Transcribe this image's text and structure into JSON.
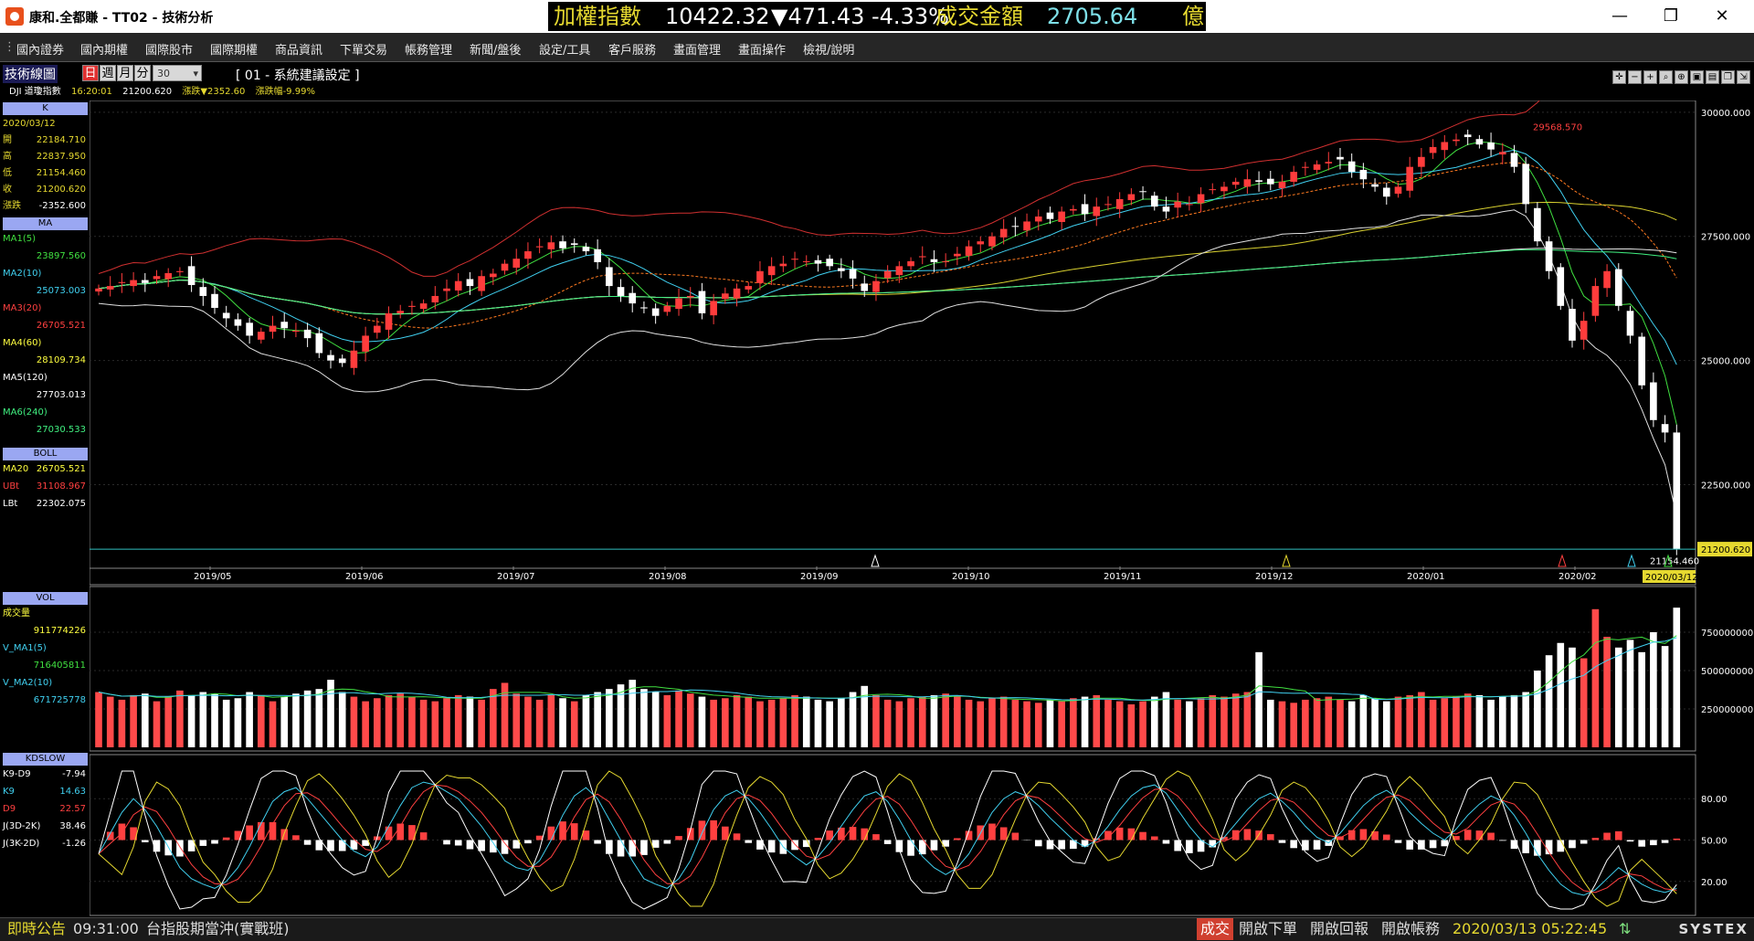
{
  "window": {
    "title": "康和.全都賺 - TT02 - 技術分析",
    "minimize": "—",
    "restore": "❐",
    "close": "✕"
  },
  "ticker": {
    "name": "加權指數",
    "value": "10422.32",
    "change": "▼471.43",
    "pct": "-4.33%",
    "vol_label": "成交金額",
    "vol_value": "2705.64",
    "unit": "億"
  },
  "menu": [
    "國內證券",
    "國內期權",
    "國際股市",
    "國際期權",
    "商品資訊",
    "下單交易",
    "帳務管理",
    "新聞/盤後",
    "設定/工具",
    "客戶服務",
    "畫面管理",
    "畫面操作",
    "檢視/說明"
  ],
  "toolbar": {
    "title": "技術線圖",
    "periods": [
      "日",
      "週",
      "月",
      "分"
    ],
    "period_value": "30",
    "setting": "[ 01 - 系統建議設定 ]",
    "symbol": "DJI 道瓊指數",
    "time": "16:20:01",
    "price": "21200.620",
    "change": "漲跌▼2352.60",
    "pct": "漲跌幅-9.99%"
  },
  "panel_k": {
    "title": "K",
    "date": "2020/03/12",
    "rows": [
      {
        "label": "開",
        "value": "22184.710"
      },
      {
        "label": "高",
        "value": "22837.950"
      },
      {
        "label": "低",
        "value": "21154.460"
      },
      {
        "label": "收",
        "value": "21200.620"
      },
      {
        "label": "漲跌",
        "value": "-2352.600"
      }
    ]
  },
  "panel_ma": {
    "title": "MA",
    "rows": [
      {
        "label": "MA1(5)",
        "value": "23897.560",
        "color": "#40e040"
      },
      {
        "label": "MA2(10)",
        "value": "25073.003",
        "color": "#40d0f0"
      },
      {
        "label": "MA3(20)",
        "value": "26705.521",
        "color": "#ff4040"
      },
      {
        "label": "MA4(60)",
        "value": "28109.734",
        "color": "#ffff40"
      },
      {
        "label": "MA5(120)",
        "value": "27703.013",
        "color": "#ffffff"
      },
      {
        "label": "MA6(240)",
        "value": "27030.533",
        "color": "#40f080"
      }
    ]
  },
  "panel_boll": {
    "title": "BOLL",
    "rows": [
      {
        "label": "MA20",
        "value": "26705.521",
        "color": "#ffff40"
      },
      {
        "label": "UBt",
        "value": "31108.967",
        "color": "#ff4040"
      },
      {
        "label": "LBt",
        "value": "22302.075",
        "color": "#ffffff"
      }
    ]
  },
  "panel_vol": {
    "title": "VOL",
    "rows": [
      {
        "label": "成交量",
        "value": "",
        "color": "#ffff40"
      },
      {
        "label": "",
        "value": "911774226",
        "color": "#ffff40"
      },
      {
        "label": "V_MA1(5)",
        "value": "",
        "color": "#40d0f0"
      },
      {
        "label": "",
        "value": "716405811",
        "color": "#40e040"
      },
      {
        "label": "V_MA2(10)",
        "value": "",
        "color": "#40d0f0"
      },
      {
        "label": "",
        "value": "671725778",
        "color": "#40d0f0"
      }
    ]
  },
  "panel_kd": {
    "title": "KDSLOW",
    "rows": [
      {
        "label": "K9-D9",
        "value": "-7.94",
        "color": "#ffffff"
      },
      {
        "label": "K9",
        "value": "14.63",
        "color": "#40d0f0"
      },
      {
        "label": "D9",
        "value": "22.57",
        "color": "#ff4040"
      },
      {
        "label": "J(3D-2K)",
        "value": "38.46",
        "color": "#ffffff"
      },
      {
        "label": "J(3K-2D)",
        "value": "-1.26",
        "color": "#ffffff"
      }
    ]
  },
  "chart_data": {
    "type": "candlestick",
    "symbol": "DJI 道瓊指數",
    "x_ticks": [
      "2019/05",
      "2019/06",
      "2019/07",
      "2019/08",
      "2019/09",
      "2019/10",
      "2019/11",
      "2019/12",
      "2020/01",
      "2020/02",
      "2020/03"
    ],
    "price_ticks": [
      "30000.000",
      "27500.000",
      "25000.000",
      "22500.000"
    ],
    "vol_ticks": [
      "750000000",
      "500000000",
      "250000000"
    ],
    "kd_ticks": [
      "80.00",
      "50.00",
      "20.00"
    ],
    "price_ylim": [
      21000,
      30200
    ],
    "high_marker": "29568.570",
    "low_marker": "21154.460",
    "last_price": "21200.620",
    "last_date": "2020/03/12",
    "close_series": [
      26450,
      26500,
      26580,
      26620,
      26560,
      26700,
      26760,
      26800,
      26520,
      26300,
      26060,
      25850,
      25700,
      25500,
      25580,
      25700,
      25650,
      25600,
      25450,
      25150,
      25000,
      24950,
      25200,
      25500,
      25700,
      25950,
      26000,
      26100,
      26150,
      26300,
      26450,
      26600,
      26500,
      26700,
      26750,
      26950,
      27050,
      27200,
      27300,
      27380,
      27260,
      27330,
      27200,
      26980,
      26500,
      26300,
      26150,
      26050,
      25900,
      26100,
      26250,
      26300,
      25950,
      26200,
      26350,
      26450,
      26500,
      26800,
      26900,
      26950,
      27050,
      27000,
      26950,
      26900,
      26800,
      26650,
      26400,
      26600,
      26800,
      26900,
      27000,
      27100,
      26980,
      27000,
      27150,
      27300,
      27400,
      27500,
      27650,
      27700,
      27800,
      27900,
      27850,
      28000,
      28050,
      27950,
      28100,
      28150,
      28250,
      28350,
      28400,
      28100,
      28000,
      28200,
      28150,
      28350,
      28450,
      28500,
      28600,
      28650,
      28600,
      28550,
      28600,
      28800,
      28900,
      28950,
      29000,
      29050,
      28800,
      28650,
      28500,
      28300,
      28500,
      28900,
      29100,
      29300,
      29400,
      29450,
      29500,
      29350,
      29250,
      29200,
      28900,
      28150,
      27400,
      26800,
      26100,
      25400,
      25800,
      26500,
      26800,
      26100,
      25500,
      24500,
      23800,
      23550,
      21200
    ],
    "volume_series": [
      0.36,
      0.33,
      0.31,
      0.34,
      0.35,
      0.3,
      0.33,
      0.37,
      0.34,
      0.36,
      0.35,
      0.31,
      0.32,
      0.36,
      0.34,
      0.3,
      0.33,
      0.35,
      0.37,
      0.38,
      0.44,
      0.36,
      0.33,
      0.3,
      0.32,
      0.34,
      0.35,
      0.33,
      0.31,
      0.3,
      0.32,
      0.34,
      0.33,
      0.31,
      0.38,
      0.42,
      0.35,
      0.33,
      0.31,
      0.34,
      0.32,
      0.3,
      0.34,
      0.36,
      0.38,
      0.41,
      0.44,
      0.38,
      0.36,
      0.34,
      0.37,
      0.35,
      0.33,
      0.31,
      0.32,
      0.34,
      0.33,
      0.3,
      0.31,
      0.32,
      0.34,
      0.33,
      0.31,
      0.3,
      0.32,
      0.36,
      0.4,
      0.34,
      0.31,
      0.3,
      0.32,
      0.33,
      0.34,
      0.35,
      0.33,
      0.31,
      0.3,
      0.32,
      0.33,
      0.31,
      0.3,
      0.29,
      0.31,
      0.3,
      0.32,
      0.33,
      0.34,
      0.31,
      0.3,
      0.28,
      0.3,
      0.33,
      0.36,
      0.31,
      0.3,
      0.32,
      0.34,
      0.33,
      0.35,
      0.36,
      0.62,
      0.31,
      0.3,
      0.29,
      0.31,
      0.32,
      0.33,
      0.31,
      0.3,
      0.34,
      0.32,
      0.3,
      0.33,
      0.34,
      0.36,
      0.31,
      0.32,
      0.33,
      0.35,
      0.34,
      0.31,
      0.33,
      0.34,
      0.36,
      0.5,
      0.6,
      0.68,
      0.65,
      0.58,
      0.9,
      0.72,
      0.65,
      0.7,
      0.62,
      0.75,
      0.66,
      0.91
    ],
    "k9": [
      40,
      55,
      70,
      80,
      72,
      60,
      45,
      30,
      22,
      18,
      15,
      20,
      30,
      45,
      62,
      78,
      85,
      88,
      80,
      70,
      60,
      50,
      42,
      38,
      45,
      60,
      75,
      88,
      92,
      90,
      85,
      80,
      70,
      60,
      48,
      35,
      30,
      28,
      35,
      50,
      68,
      82,
      88,
      80,
      65,
      50,
      35,
      22,
      18,
      15,
      22,
      35,
      55,
      72,
      82,
      86,
      80,
      70,
      58,
      45,
      38,
      32,
      38,
      48,
      60,
      72,
      82,
      85,
      78,
      65,
      50,
      38,
      30,
      25,
      30,
      40,
      55,
      70,
      80,
      85,
      82,
      75,
      66,
      58,
      50,
      45,
      50,
      60,
      72,
      82,
      88,
      90,
      84,
      72,
      60,
      50,
      45,
      52,
      62,
      72,
      80,
      84,
      78,
      70,
      60,
      52,
      48,
      55,
      65,
      75,
      82,
      86,
      80,
      70,
      62,
      55,
      50,
      58,
      68,
      76,
      82,
      78,
      68,
      55,
      40,
      28,
      18,
      12,
      10,
      14,
      22,
      30,
      24,
      18,
      14,
      12,
      15
    ]
  }
}
